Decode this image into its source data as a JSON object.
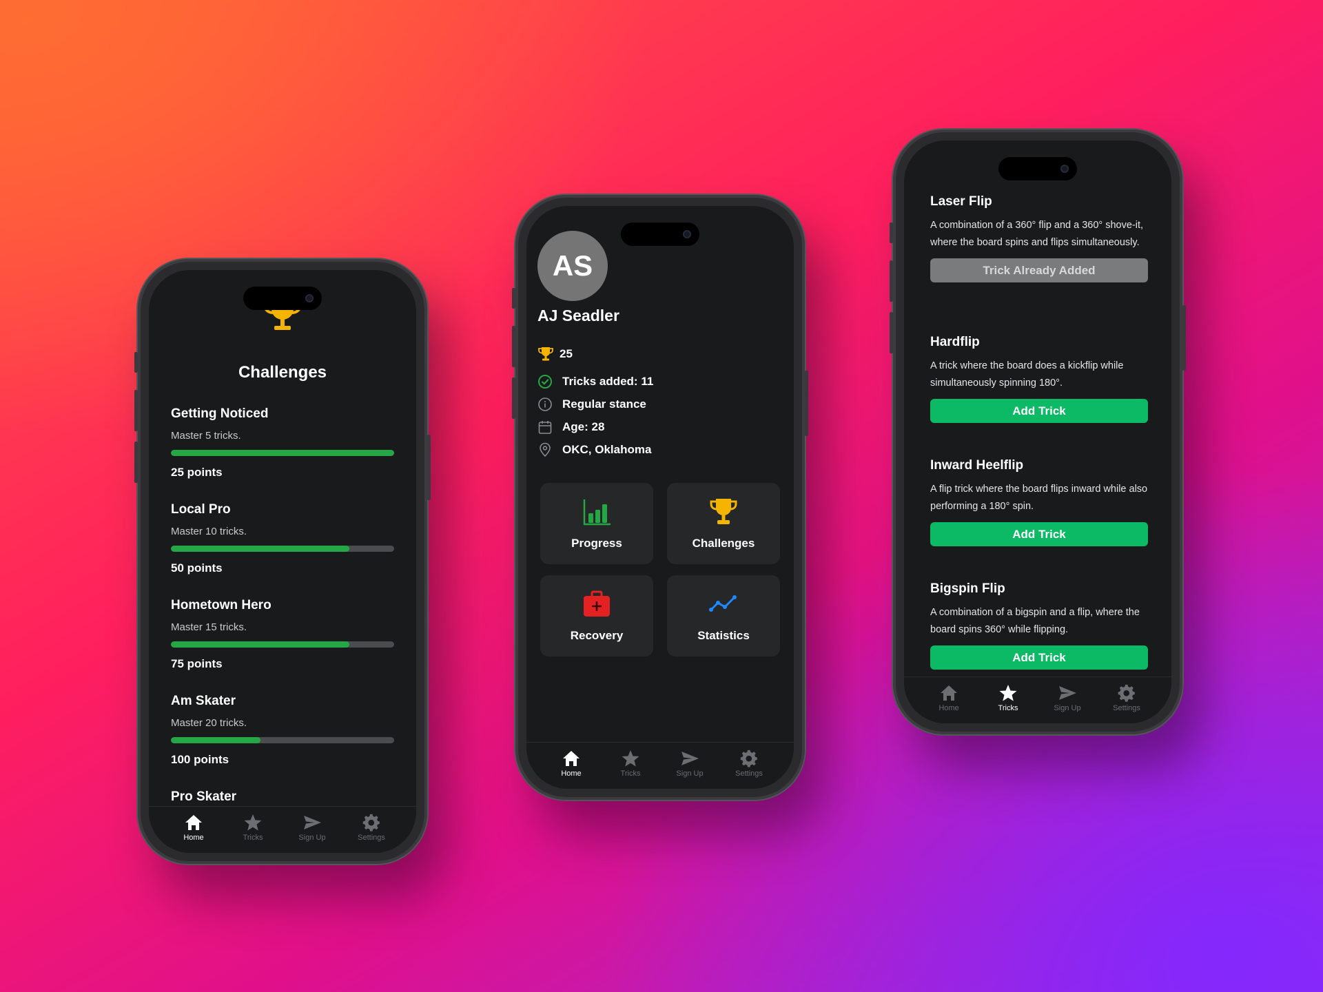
{
  "colors": {
    "screen_bg": "#181a1b",
    "card_bg": "#252729",
    "accent_green": "#0cba66",
    "progress_green": "#24a744",
    "trophy_gold": "#f5b400",
    "recovery_red": "#e52222",
    "statistics_blue": "#1e88ff"
  },
  "tabbar": {
    "items": [
      {
        "label": "Home",
        "icon": "home-icon"
      },
      {
        "label": "Tricks",
        "icon": "star-icon"
      },
      {
        "label": "Sign Up",
        "icon": "send-icon"
      },
      {
        "label": "Settings",
        "icon": "gear-icon"
      }
    ]
  },
  "challenges_screen": {
    "title": "Challenges",
    "active_tab": "Home",
    "challenges": [
      {
        "title": "Getting Noticed",
        "description": "Master 5 tricks.",
        "progress": 1.0,
        "points": "25 points"
      },
      {
        "title": "Local Pro",
        "description": "Master 10 tricks.",
        "progress": 0.8,
        "points": "50 points"
      },
      {
        "title": "Hometown Hero",
        "description": "Master 15 tricks.",
        "progress": 0.8,
        "points": "75 points"
      },
      {
        "title": "Am Skater",
        "description": "Master 20 tricks.",
        "progress": 0.4,
        "points": "100 points"
      },
      {
        "title": "Pro Skater"
      }
    ]
  },
  "profile_screen": {
    "active_tab": "Home",
    "avatar_initials": "AS",
    "name": "AJ Seadler",
    "points": "25",
    "tricks_added": "Tricks added: 11",
    "stance": "Regular stance",
    "age": "Age: 28",
    "location": "OKC, Oklahoma",
    "tiles": [
      {
        "label": "Progress",
        "icon": "bar-chart-icon"
      },
      {
        "label": "Challenges",
        "icon": "trophy-icon"
      },
      {
        "label": "Recovery",
        "icon": "first-aid-kit-icon"
      },
      {
        "label": "Statistics",
        "icon": "trend-line-icon"
      }
    ]
  },
  "tricks_screen": {
    "active_tab": "Tricks",
    "tricks": [
      {
        "name": "Laser Flip",
        "description": "A combination of a 360° flip and a 360° shove-it, where the board spins and flips simultaneously.",
        "button": "Trick Already Added",
        "added": true
      },
      {
        "name": "Hardflip",
        "description": "A trick where the board does a kickflip while simultaneously spinning 180°.",
        "button": "Add Trick",
        "added": false
      },
      {
        "name": "Inward Heelflip",
        "description": "A flip trick where the board flips inward while also performing a 180° spin.",
        "button": "Add Trick",
        "added": false
      },
      {
        "name": "Bigspin Flip",
        "description": "A combination of a bigspin and a flip, where the board spins 360° while flipping.",
        "button": "Add Trick",
        "added": false
      }
    ]
  }
}
